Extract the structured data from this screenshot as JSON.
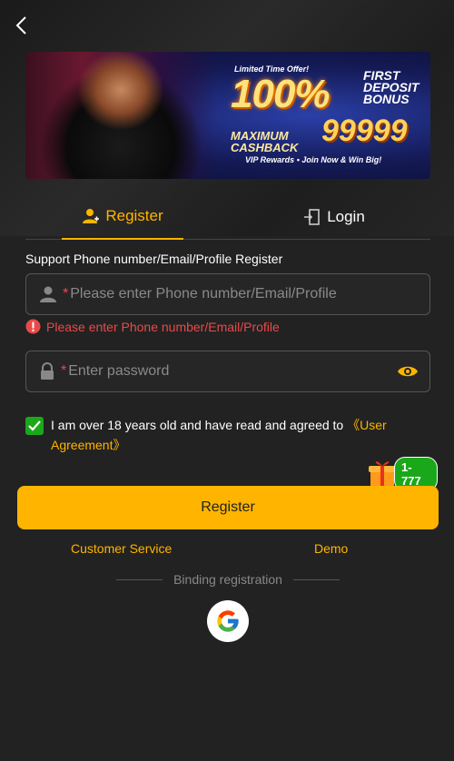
{
  "nav": {
    "back_icon": "chevron-left-icon"
  },
  "banner": {
    "limited": "Limited Time Offer!",
    "percent": "100%",
    "first_deposit": "FIRST DEPOSIT BONUS",
    "max_cashback": "MAXIMUM CASHBACK",
    "amount": "99999",
    "vip": "VIP Rewards • Join Now & Win Big!"
  },
  "tabs": [
    {
      "label": "Register",
      "icon": "user-add-icon",
      "active": true
    },
    {
      "label": "Login",
      "icon": "door-login-icon",
      "active": false
    }
  ],
  "form": {
    "support_text": "Support Phone number/Email/Profile Register",
    "phone_placeholder": "Please enter Phone number/Email/Profile",
    "phone_value": "",
    "phone_error": "Please enter Phone number/Email/Profile",
    "password_placeholder": "Enter password",
    "password_value": "",
    "required_mark": "*"
  },
  "agreement": {
    "checked": true,
    "text": "I am over 18 years old and have read and agreed to ",
    "link": "《User Agreement》"
  },
  "gift": {
    "badge": "1-777"
  },
  "register_button": "Register",
  "links": {
    "customer_service": "Customer Service",
    "demo": "Demo"
  },
  "binding": {
    "label": "Binding registration"
  },
  "colors": {
    "accent": "#ffb400",
    "background": "#222222",
    "error": "#e84a4a",
    "check": "#1aa81a"
  }
}
